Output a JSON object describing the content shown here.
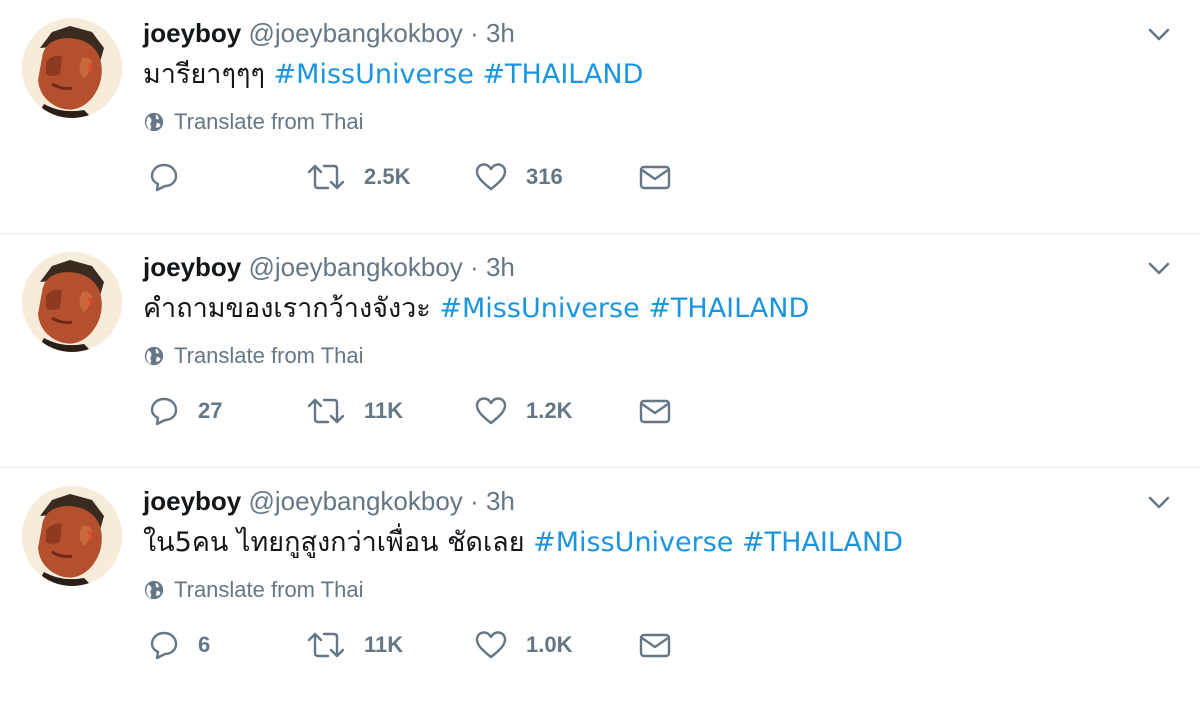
{
  "tweets": [
    {
      "fullname": "joeyboy",
      "handle": "@joeybangkokboy",
      "separator": "·",
      "time": "3h",
      "text": "มารียาๆๆๆ ",
      "hashtags": [
        "#MissUniverse",
        "#THAILAND"
      ],
      "translate_label": "Translate from Thai",
      "reply_count": "",
      "retweet_count": "2.5K",
      "like_count": "316"
    },
    {
      "fullname": "joeyboy",
      "handle": "@joeybangkokboy",
      "separator": "·",
      "time": "3h",
      "text": "คำถามของเรากว้างจังวะ ",
      "hashtags": [
        "#MissUniverse",
        "#THAILAND"
      ],
      "translate_label": "Translate from Thai",
      "reply_count": "27",
      "retweet_count": "11K",
      "like_count": "1.2K"
    },
    {
      "fullname": "joeyboy",
      "handle": "@joeybangkokboy",
      "separator": "·",
      "time": "3h",
      "text": "ใน5คน ไทยกูสูงกว่าเพื่อน ชัดเลย ",
      "hashtags": [
        "#MissUniverse",
        "#THAILAND"
      ],
      "translate_label": "Translate from Thai",
      "reply_count": "6",
      "retweet_count": "11K",
      "like_count": "1.0K"
    }
  ],
  "colors": {
    "hashtag": "#1b95e0",
    "secondary": "#657786",
    "primary_text": "#14171a",
    "divider": "#e6ecf0"
  },
  "icons": [
    "avatar",
    "globe-icon",
    "reply-icon",
    "retweet-icon",
    "like-icon",
    "direct-message-icon",
    "chevron-down-icon"
  ]
}
